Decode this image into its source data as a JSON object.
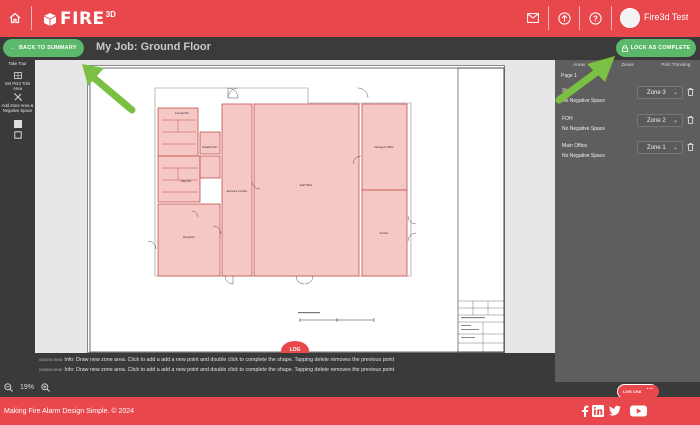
{
  "topbar": {
    "logo_text": "FIRE",
    "logo_sup": "3D",
    "user_name": "Fire3d Test",
    "icons": [
      "home-icon",
      "mail-icon",
      "upload-icon",
      "help-icon"
    ]
  },
  "header": {
    "back_label": "BACK TO SUMMARY",
    "title": "My Job: Ground Floor",
    "lock_label": "LOCK AS COMPLETE"
  },
  "left_tools": {
    "take_tour": "Take Tour",
    "print_area": "Set Print Trim Area",
    "add_zone": "Add Zone Area & Negative Space"
  },
  "right_panel": {
    "tabs": [
      "Areas",
      "Zones",
      "Print Trimming"
    ],
    "page_label": "Page 1",
    "zones": [
      {
        "name": "Stairs",
        "sub": "No Negative Space",
        "zone": "Zone 3"
      },
      {
        "name": "FOH",
        "sub": "No Negative Space",
        "zone": "Zone 2"
      },
      {
        "name": "Main Office",
        "sub": "No Negative Space",
        "zone": "Zone 1"
      }
    ]
  },
  "floorplan": {
    "rooms": [
      "Female WC",
      "Disabled WC",
      "Male WC",
      "Entrance Corridor",
      "Staff Office",
      "Managers Office",
      "Kitchen",
      "Reception"
    ]
  },
  "info": {
    "lines": [
      {
        "time": "03/05/24 09:50",
        "text": "Info: Draw new zone area. Click to add a add a new point and double click to complete the shape. Tapping delete removes the previous point"
      },
      {
        "time": "03/05/24 09:50",
        "text": "Info: Draw new zone area. Click to add a add a new point and double click to complete the shape. Tapping delete removes the previous point"
      }
    ],
    "log_label": "LOG"
  },
  "zoom": {
    "value": "19%"
  },
  "livechat": {
    "label": "LIVE CHAT",
    "dots": "···"
  },
  "footer": {
    "text": "Making Fire Alarm Design Simple. © 2024",
    "social": [
      "facebook-icon",
      "linkedin-icon",
      "twitter-icon",
      "youtube-icon"
    ]
  },
  "colors": {
    "brand_red": "#e8474b",
    "accent_green": "#5cb86a",
    "room_fill": "#f5c7c5",
    "room_stroke": "#c0504d"
  }
}
